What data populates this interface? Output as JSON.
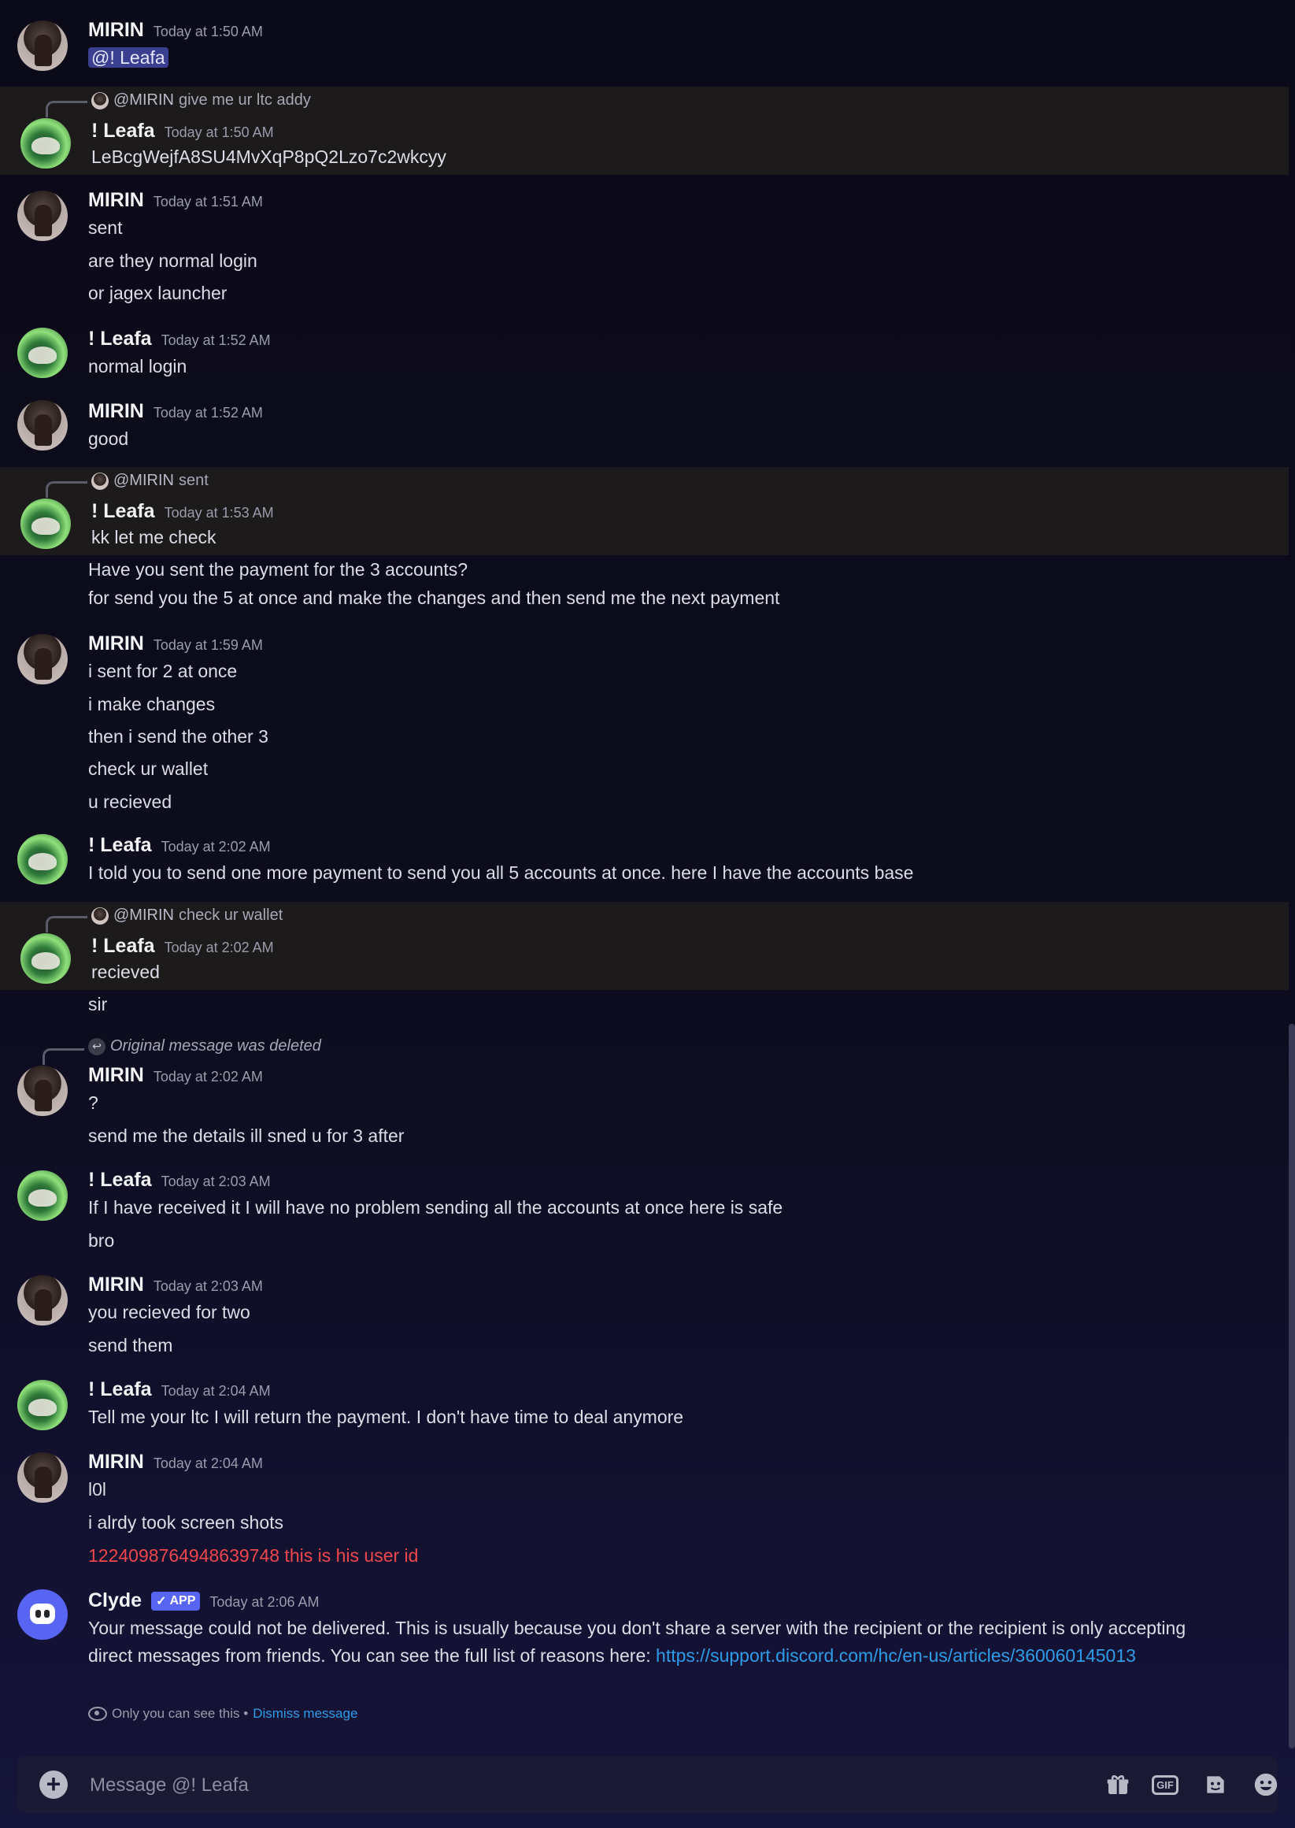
{
  "conversation": {
    "users": {
      "mirin": "MIRIN",
      "leafa": "! Leafa",
      "clyde": "Clyde"
    },
    "messages": [
      {
        "author": "MIRIN",
        "time": "Today at 1:50 AM",
        "mention": "@! Leafa"
      },
      {
        "reply_to": "@MIRIN",
        "reply_text": "give me ur ltc addy",
        "author": "! Leafa",
        "time": "Today at 1:50 AM",
        "lines": [
          "LeBcgWejfA8SU4MvXqP8pQ2Lzo7c2wkcyy"
        ]
      },
      {
        "author": "MIRIN",
        "time": "Today at 1:51 AM",
        "lines": [
          "sent",
          "are they normal login",
          "or jagex launcher"
        ]
      },
      {
        "author": "! Leafa",
        "time": "Today at 1:52 AM",
        "lines": [
          "normal login"
        ]
      },
      {
        "author": "MIRIN",
        "time": "Today at 1:52 AM",
        "lines": [
          "good"
        ]
      },
      {
        "reply_to": "@MIRIN",
        "reply_text": "sent",
        "author": "! Leafa",
        "time": "Today at 1:53 AM",
        "lines": [
          "kk let me check",
          "Have you sent the payment for the 3 accounts?",
          "for send you the 5 at once and make the changes and then send me the next payment"
        ]
      },
      {
        "author": "MIRIN",
        "time": "Today at 1:59 AM",
        "lines": [
          "i sent for 2 at once",
          "i make changes",
          "then i send the other 3",
          "check ur wallet",
          "u recieved"
        ]
      },
      {
        "author": "! Leafa",
        "time": "Today at 2:02 AM",
        "lines": [
          "I told you to send one more payment to send you all 5 accounts at once. here I have the accounts base"
        ]
      },
      {
        "reply_to": "@MIRIN",
        "reply_text": "check ur wallet",
        "author": "! Leafa",
        "time": "Today at 2:02 AM",
        "lines": [
          "recieved",
          "sir"
        ]
      },
      {
        "reply_deleted": "Original message was deleted",
        "author": "MIRIN",
        "time": "Today at 2:02 AM",
        "lines": [
          "?",
          "send me the details ill sned u for 3 after"
        ]
      },
      {
        "author": "! Leafa",
        "time": "Today at 2:03 AM",
        "lines": [
          "If I have received it I will have no problem sending all the accounts at once here is safe",
          "bro"
        ]
      },
      {
        "author": "MIRIN",
        "time": "Today at 2:03 AM",
        "lines": [
          "you recieved for two",
          "send them"
        ]
      },
      {
        "author": "! Leafa",
        "time": "Today at 2:04 AM",
        "lines": [
          "Tell me your ltc I will return the payment. I don't have time to deal anymore"
        ]
      },
      {
        "author": "MIRIN",
        "time": "Today at 2:04 AM",
        "lines": [
          "l0l",
          "i alrdy took screen shots",
          "1224098764948639748 this is his user id"
        ]
      },
      {
        "author": "Clyde",
        "badge": "APP",
        "time": "Today at 2:06 AM",
        "text": "Your message could not be delivered. This is usually because you don't share a server with the recipient or the recipient is only accepting direct messages from friends. You can see the full list of reasons here: ",
        "link": "https://support.discord.com/hc/en-us/articles/360060145013",
        "only_you": "Only you can see this •",
        "dismiss": "Dismiss message"
      }
    ]
  },
  "composer": {
    "placeholder": "Message @! Leafa"
  },
  "icons": [
    "add-attachment-icon",
    "gift-icon",
    "gif-icon",
    "sticker-icon",
    "emoji-icon",
    "check-icon",
    "eye-icon",
    "reply-arrow-icon"
  ],
  "colors": {
    "accent": "#5865f2",
    "link": "#2f9ce8",
    "alert_text": "#f0474c",
    "reply_highlight": "#1c1a1b"
  }
}
